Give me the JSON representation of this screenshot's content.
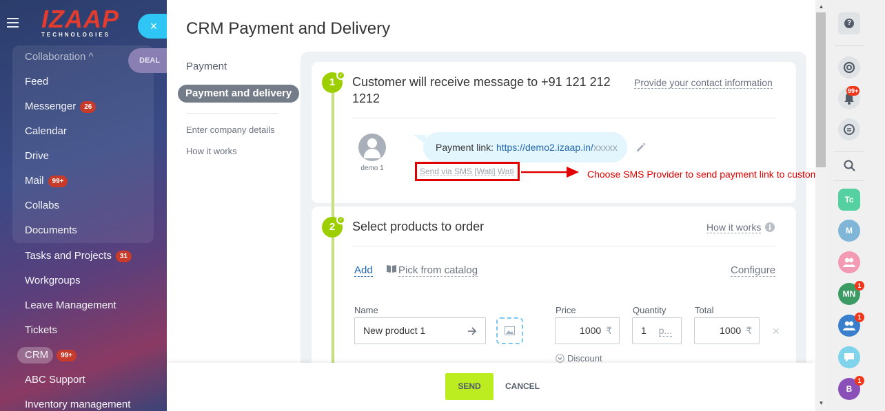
{
  "sidebar": {
    "logo_main": "IZAAP",
    "logo_sub": "TECHNOLOGIES",
    "close_label": "×",
    "deal_label": "DEAL",
    "items": [
      {
        "label": "Collaboration ^",
        "counter": ""
      },
      {
        "label": "Feed",
        "counter": ""
      },
      {
        "label": "Messenger",
        "counter": "26"
      },
      {
        "label": "Calendar",
        "counter": ""
      },
      {
        "label": "Drive",
        "counter": ""
      },
      {
        "label": "Mail",
        "counter": "99+"
      },
      {
        "label": "Collabs",
        "counter": ""
      },
      {
        "label": "Documents",
        "counter": ""
      },
      {
        "label": "Tasks and Projects",
        "counter": "31"
      },
      {
        "label": "Workgroups",
        "counter": ""
      },
      {
        "label": "Leave Management",
        "counter": ""
      },
      {
        "label": "Tickets",
        "counter": ""
      },
      {
        "label": "CRM",
        "counter": "99+"
      },
      {
        "label": "ABC Support",
        "counter": ""
      },
      {
        "label": "Inventory management",
        "counter": ""
      }
    ]
  },
  "page": {
    "title": "CRM Payment and Delivery"
  },
  "left_menu": {
    "payment": "Payment",
    "payment_delivery": "Payment and delivery",
    "enter_company": "Enter company details",
    "how_it_works": "How it works"
  },
  "step1": {
    "number": "1",
    "heading_line1": "Customer will receive message to +91 121 212",
    "heading_line2": "1212",
    "contact_link": "Provide your contact information",
    "avatar_name": "demo 1",
    "bubble_prefix": "Payment link: ",
    "bubble_link": "https://demo2.izaap.in/",
    "bubble_suffix": "xxxxx",
    "sms_provider": "Send via SMS [Wati] Wati",
    "annotation": "Choose SMS Provider to send payment link to customer"
  },
  "step2": {
    "number": "2",
    "heading": "Select products to order",
    "how_link": "How it works",
    "add_label": "Add",
    "catalog_label": "Pick from catalog",
    "configure_label": "Configure",
    "name_label": "Name",
    "name_value": "New product 1",
    "price_label": "Price",
    "price_value": "1000",
    "currency": "₹",
    "quantity_label": "Quantity",
    "quantity_value": "1",
    "quantity_unit": "p...",
    "total_label": "Total",
    "total_value": "1000",
    "discount_label": "Discount"
  },
  "footer": {
    "send_label": "SEND",
    "cancel_label": "CANCEL"
  },
  "rightbar": {
    "help_label": "?",
    "notifications_badge": "99+",
    "avatars": [
      {
        "initials": "Tc",
        "color": "#55d0a0",
        "badge": ""
      },
      {
        "initials": "M",
        "color": "#7fb6d8",
        "badge": ""
      },
      {
        "initials": "",
        "color": "#f39bb4",
        "badge": ""
      },
      {
        "initials": "MN",
        "color": "#3b9b63",
        "badge": "1"
      },
      {
        "initials": "",
        "color": "#3a7fcb",
        "badge": "1"
      },
      {
        "initials": "",
        "color": "#7fd3ea",
        "badge": ""
      },
      {
        "initials": "B",
        "color": "#8b4fb8",
        "badge": "1"
      }
    ]
  },
  "colors": {
    "accent": "#2fc6f6",
    "step_green": "#9dcf00",
    "send_green": "#bbed21",
    "annotation_red": "#e00000"
  }
}
